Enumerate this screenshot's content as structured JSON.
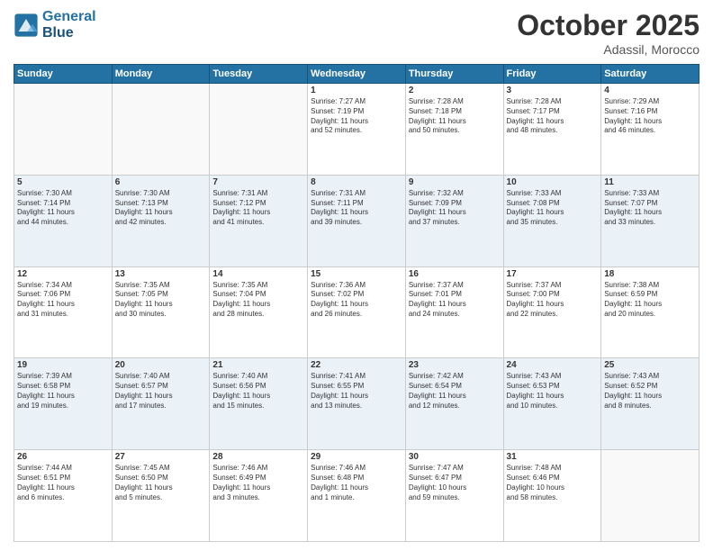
{
  "header": {
    "logo_line1": "General",
    "logo_line2": "Blue",
    "month": "October 2025",
    "location": "Adassil, Morocco"
  },
  "weekdays": [
    "Sunday",
    "Monday",
    "Tuesday",
    "Wednesday",
    "Thursday",
    "Friday",
    "Saturday"
  ],
  "weeks": [
    [
      {
        "day": "",
        "info": ""
      },
      {
        "day": "",
        "info": ""
      },
      {
        "day": "",
        "info": ""
      },
      {
        "day": "1",
        "info": "Sunrise: 7:27 AM\nSunset: 7:19 PM\nDaylight: 11 hours\nand 52 minutes."
      },
      {
        "day": "2",
        "info": "Sunrise: 7:28 AM\nSunset: 7:18 PM\nDaylight: 11 hours\nand 50 minutes."
      },
      {
        "day": "3",
        "info": "Sunrise: 7:28 AM\nSunset: 7:17 PM\nDaylight: 11 hours\nand 48 minutes."
      },
      {
        "day": "4",
        "info": "Sunrise: 7:29 AM\nSunset: 7:16 PM\nDaylight: 11 hours\nand 46 minutes."
      }
    ],
    [
      {
        "day": "5",
        "info": "Sunrise: 7:30 AM\nSunset: 7:14 PM\nDaylight: 11 hours\nand 44 minutes."
      },
      {
        "day": "6",
        "info": "Sunrise: 7:30 AM\nSunset: 7:13 PM\nDaylight: 11 hours\nand 42 minutes."
      },
      {
        "day": "7",
        "info": "Sunrise: 7:31 AM\nSunset: 7:12 PM\nDaylight: 11 hours\nand 41 minutes."
      },
      {
        "day": "8",
        "info": "Sunrise: 7:31 AM\nSunset: 7:11 PM\nDaylight: 11 hours\nand 39 minutes."
      },
      {
        "day": "9",
        "info": "Sunrise: 7:32 AM\nSunset: 7:09 PM\nDaylight: 11 hours\nand 37 minutes."
      },
      {
        "day": "10",
        "info": "Sunrise: 7:33 AM\nSunset: 7:08 PM\nDaylight: 11 hours\nand 35 minutes."
      },
      {
        "day": "11",
        "info": "Sunrise: 7:33 AM\nSunset: 7:07 PM\nDaylight: 11 hours\nand 33 minutes."
      }
    ],
    [
      {
        "day": "12",
        "info": "Sunrise: 7:34 AM\nSunset: 7:06 PM\nDaylight: 11 hours\nand 31 minutes."
      },
      {
        "day": "13",
        "info": "Sunrise: 7:35 AM\nSunset: 7:05 PM\nDaylight: 11 hours\nand 30 minutes."
      },
      {
        "day": "14",
        "info": "Sunrise: 7:35 AM\nSunset: 7:04 PM\nDaylight: 11 hours\nand 28 minutes."
      },
      {
        "day": "15",
        "info": "Sunrise: 7:36 AM\nSunset: 7:02 PM\nDaylight: 11 hours\nand 26 minutes."
      },
      {
        "day": "16",
        "info": "Sunrise: 7:37 AM\nSunset: 7:01 PM\nDaylight: 11 hours\nand 24 minutes."
      },
      {
        "day": "17",
        "info": "Sunrise: 7:37 AM\nSunset: 7:00 PM\nDaylight: 11 hours\nand 22 minutes."
      },
      {
        "day": "18",
        "info": "Sunrise: 7:38 AM\nSunset: 6:59 PM\nDaylight: 11 hours\nand 20 minutes."
      }
    ],
    [
      {
        "day": "19",
        "info": "Sunrise: 7:39 AM\nSunset: 6:58 PM\nDaylight: 11 hours\nand 19 minutes."
      },
      {
        "day": "20",
        "info": "Sunrise: 7:40 AM\nSunset: 6:57 PM\nDaylight: 11 hours\nand 17 minutes."
      },
      {
        "day": "21",
        "info": "Sunrise: 7:40 AM\nSunset: 6:56 PM\nDaylight: 11 hours\nand 15 minutes."
      },
      {
        "day": "22",
        "info": "Sunrise: 7:41 AM\nSunset: 6:55 PM\nDaylight: 11 hours\nand 13 minutes."
      },
      {
        "day": "23",
        "info": "Sunrise: 7:42 AM\nSunset: 6:54 PM\nDaylight: 11 hours\nand 12 minutes."
      },
      {
        "day": "24",
        "info": "Sunrise: 7:43 AM\nSunset: 6:53 PM\nDaylight: 11 hours\nand 10 minutes."
      },
      {
        "day": "25",
        "info": "Sunrise: 7:43 AM\nSunset: 6:52 PM\nDaylight: 11 hours\nand 8 minutes."
      }
    ],
    [
      {
        "day": "26",
        "info": "Sunrise: 7:44 AM\nSunset: 6:51 PM\nDaylight: 11 hours\nand 6 minutes."
      },
      {
        "day": "27",
        "info": "Sunrise: 7:45 AM\nSunset: 6:50 PM\nDaylight: 11 hours\nand 5 minutes."
      },
      {
        "day": "28",
        "info": "Sunrise: 7:46 AM\nSunset: 6:49 PM\nDaylight: 11 hours\nand 3 minutes."
      },
      {
        "day": "29",
        "info": "Sunrise: 7:46 AM\nSunset: 6:48 PM\nDaylight: 11 hours\nand 1 minute."
      },
      {
        "day": "30",
        "info": "Sunrise: 7:47 AM\nSunset: 6:47 PM\nDaylight: 10 hours\nand 59 minutes."
      },
      {
        "day": "31",
        "info": "Sunrise: 7:48 AM\nSunset: 6:46 PM\nDaylight: 10 hours\nand 58 minutes."
      },
      {
        "day": "",
        "info": ""
      }
    ]
  ]
}
